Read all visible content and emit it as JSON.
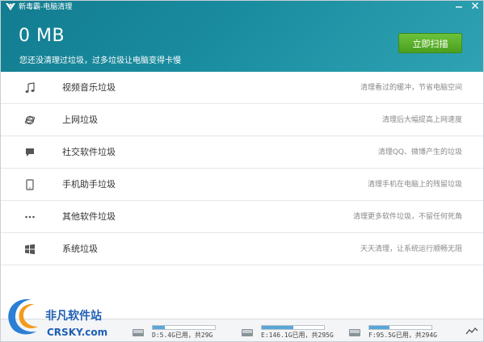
{
  "window": {
    "title": "新毒霸-电脑清理",
    "minimize_icon": "minimize-icon",
    "close_icon": "close-icon"
  },
  "header": {
    "size_text": "0 MB",
    "subtitle": "您还没清理过垃圾，过多垃圾让电脑变得卡慢",
    "scan_button": "立即扫描",
    "accent_color": "#1a8ca0",
    "button_color": "#5ab02b"
  },
  "categories": [
    {
      "icon": "music-note-icon",
      "label": "视频音乐垃圾",
      "desc": "清理看过的缓冲，节省电脑空间"
    },
    {
      "icon": "browser-ie-icon",
      "label": "上网垃圾",
      "desc": "清理后大幅提高上网速度"
    },
    {
      "icon": "chat-bubble-icon",
      "label": "社交软件垃圾",
      "desc": "清理QQ、微博产生的垃圾"
    },
    {
      "icon": "phone-icon",
      "label": "手机助手垃圾",
      "desc": "清理手机在电脑上的残留垃圾"
    },
    {
      "icon": "more-dots-icon",
      "label": "其他软件垃圾",
      "desc": "清理更多软件垃圾，不留任何死角"
    },
    {
      "icon": "windows-icon",
      "label": "系统垃圾",
      "desc": "天天清理，让系统运行顺畅无阻"
    }
  ],
  "drives": [
    {
      "text": "D:5.4G已用，共29G",
      "used_fraction": 0.19
    },
    {
      "text": "E:146.1G已用，共295G",
      "used_fraction": 0.5
    },
    {
      "text": "F:95.5G已用，共294G",
      "used_fraction": 0.32
    }
  ],
  "watermark": {
    "text": "非凡软件站",
    "sub": "CRSKY.com"
  }
}
